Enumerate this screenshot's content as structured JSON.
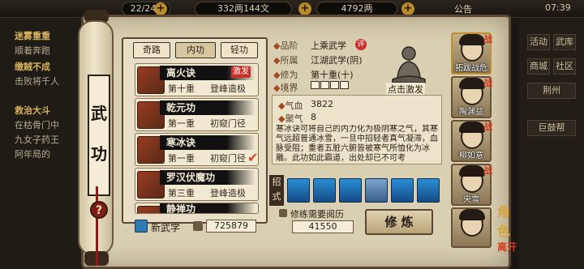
{
  "topbar": {
    "stat1": "22/240",
    "stat2": "332两144文",
    "stat3": "4792两",
    "notice": "公告",
    "time": "07:39"
  },
  "left_bg": {
    "lines": [
      "迷雾重重",
      "顺着奔跑",
      "缴贼不成",
      "击败将千人",
      "救治大斗",
      "在枯骨门中",
      "九女子药王",
      "阿年局的"
    ]
  },
  "right_bg": {
    "buttons": [
      "活动",
      "武库",
      "商城",
      "社区",
      "荆州",
      "巨鼓帮"
    ]
  },
  "scroll_title": [
    "武",
    "功"
  ],
  "tabs": [
    {
      "label": "奇路"
    },
    {
      "label": "内功"
    },
    {
      "label": "轻功"
    }
  ],
  "skills": [
    {
      "name": "离火诀",
      "level": "第十重",
      "rank": "登峰造极",
      "badge": "激发"
    },
    {
      "name": "乾元功",
      "level": "第一重",
      "rank": "初窥门径"
    },
    {
      "name": "寒冰诀",
      "level": "第一重",
      "rank": "初窥门径",
      "checked": true
    },
    {
      "name": "罗汉伏魔功",
      "level": "第三重",
      "rank": "登峰造极"
    },
    {
      "name": "静禅功",
      "level": "",
      "rank": ""
    }
  ],
  "new_skill": {
    "label": "新武学",
    "value": "725879"
  },
  "detail": {
    "grade_label": "品阶",
    "grade_value": "上乘武学",
    "grade_tag": "评",
    "school_label": "所属",
    "school_value": "江湖武学(阴)",
    "cultivation_label": "修为",
    "cultivation_value": "第十重(十)",
    "realm_label": "境界",
    "realm_level": 0,
    "avatar_caption": "点击激发",
    "qixue_label": "气血",
    "qixue_value": "3822",
    "juqi_label": "聚气",
    "juqi_value": "8",
    "description": "寒冰诀可将自己的内力化为极阴寒之气，其寒气远超普通冰雪，一旦中招轻者真气凝滞，血脉受阻；重者五脏六腑皆被寒气所恤化为冰雕。此功如此霸道，出处却已不可考"
  },
  "moves_label": "招式",
  "moves_count": 7,
  "requirement": {
    "label": "修练需要阅历",
    "value": "41550"
  },
  "practice_button": "修 炼",
  "characters": [
    {
      "name": "拓跋战危",
      "selected": true
    },
    {
      "name": "陶渊益"
    },
    {
      "name": "柳如意"
    },
    {
      "name": "央雪"
    },
    {
      "name": ""
    }
  ],
  "battle_mark": "战",
  "role_label": "角色",
  "role_sub": "离开",
  "colors": {
    "accent": "#c9302c",
    "parchment": "#d9cfb2",
    "ink": "#2a1f15"
  }
}
